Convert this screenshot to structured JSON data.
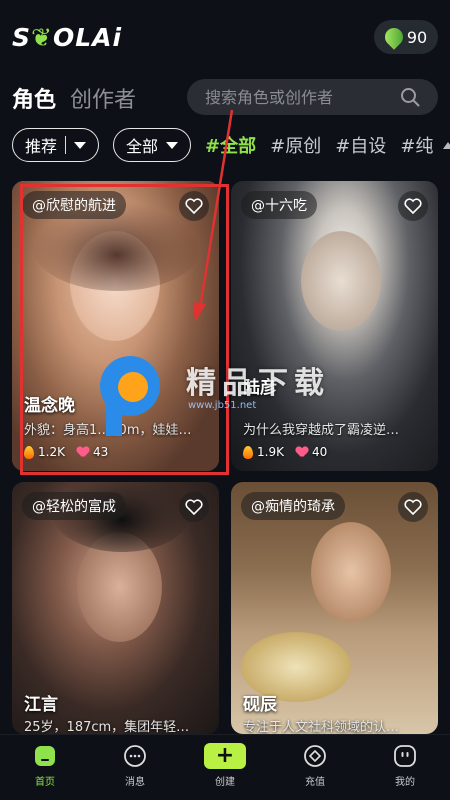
{
  "header": {
    "logo_text": "LAi",
    "logo_prefix": "S",
    "coins": "90"
  },
  "tabs": [
    {
      "label": "角色",
      "active": true
    },
    {
      "label": "创作者",
      "active": false
    }
  ],
  "search": {
    "placeholder": "搜索角色或创作者",
    "value": ""
  },
  "filters": {
    "sort": "推荐",
    "scope": "全部",
    "tags": [
      "#全部",
      "#原创",
      "#自设",
      "#纯"
    ]
  },
  "cards": [
    {
      "author": "@欣慰的航进",
      "name": "温念晚",
      "desc": "外貌：身高1…80m，娃娃…",
      "hot": "1.2K",
      "likes": "43"
    },
    {
      "author": "@十六吃",
      "name": "陆彦",
      "desc": "为什么我穿越成了霸凌逆…",
      "hot": "1.9K",
      "likes": "40"
    },
    {
      "author": "@轻松的富成",
      "name": "江言",
      "desc": "25岁，187cm，集团年轻…",
      "hot": "",
      "likes": ""
    },
    {
      "author": "@痴情的琦承",
      "name": "砚辰",
      "desc": "专注于人文社科领域的认…",
      "hot": "",
      "likes": ""
    }
  ],
  "watermark": {
    "text": "精品下载",
    "url": "www.jb51.net"
  },
  "nav": [
    {
      "label": "首页",
      "active": true
    },
    {
      "label": "消息",
      "active": false
    },
    {
      "label": "创建",
      "active": false
    },
    {
      "label": "充值",
      "active": false
    },
    {
      "label": "我的",
      "active": false
    }
  ],
  "colors": {
    "accent": "#8fe24b",
    "background": "#0d1016",
    "annotation": "#e23131"
  }
}
